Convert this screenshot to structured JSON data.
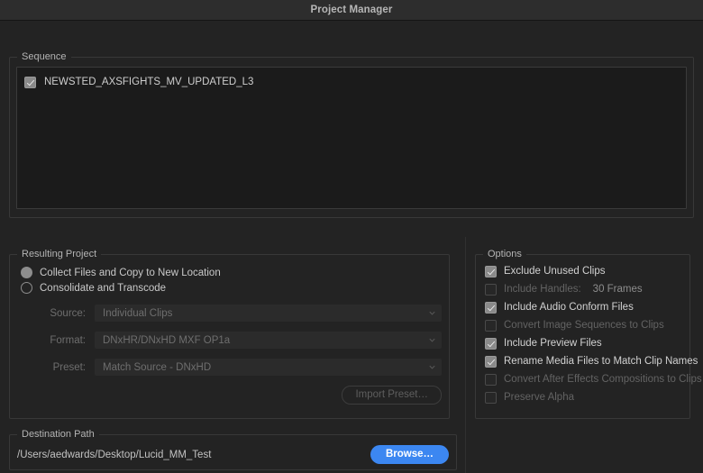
{
  "window": {
    "title": "Project Manager"
  },
  "sequence": {
    "group_title": "Sequence",
    "items": [
      {
        "label": "NEWSTED_AXSFIGHTS_MV_UPDATED_L3",
        "checked": true
      }
    ]
  },
  "resulting_project": {
    "group_title": "Resulting Project",
    "radios": [
      {
        "label": "Collect Files and Copy to New Location",
        "selected": true
      },
      {
        "label": "Consolidate and Transcode",
        "selected": false
      }
    ],
    "fields": [
      {
        "label": "Source:",
        "value": "Individual Clips",
        "icon": "chevron-down-icon"
      },
      {
        "label": "Format:",
        "value": "DNxHR/DNxHD MXF OP1a",
        "icon": "chevron-down-icon"
      },
      {
        "label": "Preset:",
        "value": "Match Source - DNxHD",
        "icon": "chevron-down-icon"
      }
    ],
    "import_preset_label": "Import Preset…"
  },
  "options": {
    "group_title": "Options",
    "items": [
      {
        "label": "Exclude Unused Clips",
        "checked": true,
        "enabled": true,
        "extra": ""
      },
      {
        "label": "Include Handles:",
        "checked": false,
        "enabled": false,
        "extra": "30 Frames"
      },
      {
        "label": "Include Audio Conform Files",
        "checked": true,
        "enabled": true,
        "extra": ""
      },
      {
        "label": "Convert Image Sequences to Clips",
        "checked": false,
        "enabled": false,
        "extra": ""
      },
      {
        "label": "Include Preview Files",
        "checked": true,
        "enabled": true,
        "extra": ""
      },
      {
        "label": "Rename Media Files to Match Clip Names",
        "checked": true,
        "enabled": true,
        "extra": ""
      },
      {
        "label": "Convert After Effects Compositions to Clips",
        "checked": false,
        "enabled": false,
        "extra": ""
      },
      {
        "label": "Preserve Alpha",
        "checked": false,
        "enabled": false,
        "extra": ""
      }
    ]
  },
  "destination": {
    "group_title": "Destination Path",
    "path": "/Users/aedwards/Desktop/Lucid_MM_Test",
    "browse_label": "Browse…"
  },
  "colors": {
    "window_bg": "#232323",
    "titlebar_bg": "#2d2d2d",
    "group_border": "#383838",
    "list_bg": "#1b1b1b",
    "field_bg": "#2b2b2b",
    "accent_blue": "#3c87f1",
    "text_primary": "#c8c8c8",
    "text_disabled": "#636363",
    "checkbox_checked": "#8a8a8a"
  }
}
